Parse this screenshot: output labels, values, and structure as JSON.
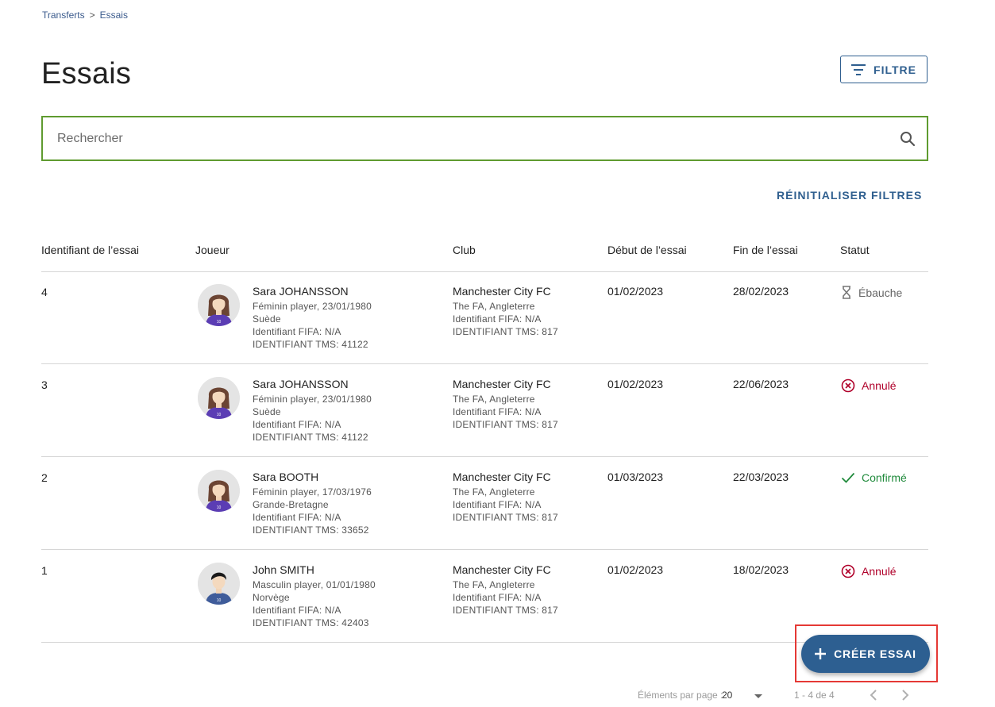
{
  "breadcrumb": {
    "parent": "Transferts",
    "separator": ">",
    "current": "Essais"
  },
  "page": {
    "title": "Essais"
  },
  "filter_button": {
    "label": "FILTRE"
  },
  "search": {
    "placeholder": "Rechercher"
  },
  "reset_filters": {
    "label": "RÉINITIALISER FILTRES"
  },
  "table": {
    "columns": {
      "id": "Identifiant de l’essai",
      "player": "Joueur",
      "club": "Club",
      "start": "Début de l’essai",
      "end": "Fin de l’essai",
      "status": "Statut"
    },
    "rows": [
      {
        "id": "4",
        "player": {
          "name": "Sara JOHANSSON",
          "info": "Féminin player, 23/01/1980",
          "country": "Suède",
          "fifa": "Identifiant FIFA: N/A",
          "tms": "IDENTIFIANT TMS: 41122"
        },
        "club": {
          "name": "Manchester City FC",
          "assoc": "The FA, Angleterre",
          "fifa": "Identifiant FIFA: N/A",
          "tms": "IDENTIFIANT TMS: 817"
        },
        "start": "01/02/2023",
        "end": "28/02/2023",
        "status": {
          "label": "Ébauche",
          "kind": "draft",
          "icon": "hourglass-icon"
        }
      },
      {
        "id": "3",
        "player": {
          "name": "Sara JOHANSSON",
          "info": "Féminin player, 23/01/1980",
          "country": "Suède",
          "fifa": "Identifiant FIFA: N/A",
          "tms": "IDENTIFIANT TMS: 41122"
        },
        "club": {
          "name": "Manchester City FC",
          "assoc": "The FA, Angleterre",
          "fifa": "Identifiant FIFA: N/A",
          "tms": "IDENTIFIANT TMS: 817"
        },
        "start": "01/02/2023",
        "end": "22/06/2023",
        "status": {
          "label": "Annulé",
          "kind": "cancel",
          "icon": "cancel-circle-icon"
        }
      },
      {
        "id": "2",
        "player": {
          "name": "Sara BOOTH",
          "info": "Féminin player, 17/03/1976",
          "country": "Grande-Bretagne",
          "fifa": "Identifiant FIFA: N/A",
          "tms": "IDENTIFIANT TMS: 33652"
        },
        "club": {
          "name": "Manchester City FC",
          "assoc": "The FA, Angleterre",
          "fifa": "Identifiant FIFA: N/A",
          "tms": "IDENTIFIANT TMS: 817"
        },
        "start": "01/03/2023",
        "end": "22/03/2023",
        "status": {
          "label": "Confirmé",
          "kind": "ok",
          "icon": "check-icon"
        }
      },
      {
        "id": "1",
        "player": {
          "name": "John SMITH",
          "info": "Masculin player, 01/01/1980",
          "country": "Norvège",
          "fifa": "Identifiant FIFA: N/A",
          "tms": "IDENTIFIANT TMS: 42403"
        },
        "club": {
          "name": "Manchester City FC",
          "assoc": "The FA, Angleterre",
          "fifa": "Identifiant FIFA: N/A",
          "tms": "IDENTIFIANT TMS: 817"
        },
        "start": "01/02/2023",
        "end": "18/02/2023",
        "status": {
          "label": "Annulé",
          "kind": "cancel",
          "icon": "cancel-circle-icon"
        }
      }
    ]
  },
  "fab": {
    "label": "CRÉER ESSAI",
    "icon": "plus-icon"
  },
  "pagination": {
    "items_per_page_label": "Éléments par page",
    "separator": ":",
    "items_per_page": "20",
    "range": "1 - 4 de 4"
  },
  "colors": {
    "accent": "#2d5f91",
    "search_border": "#5f9b30",
    "cancel": "#b0002a",
    "confirm": "#1f8a3b",
    "highlight": "#e53935"
  }
}
